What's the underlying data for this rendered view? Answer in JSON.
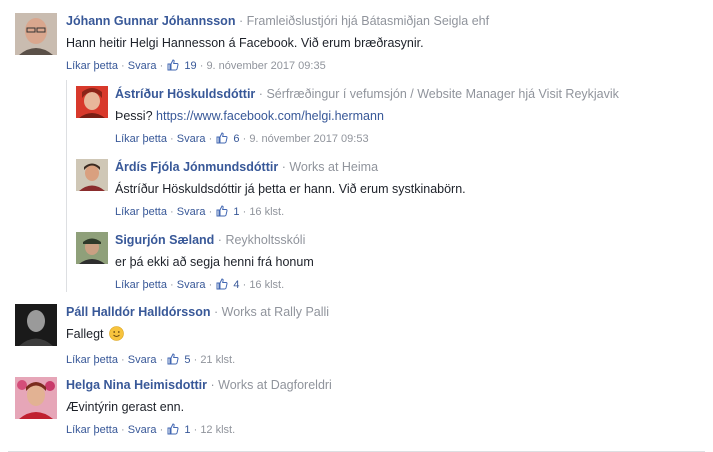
{
  "action_like": "Líkar þetta",
  "action_reply": "Svara",
  "separator": "·",
  "comments": [
    {
      "name": "Jóhann Gunnar Jóhannsson",
      "work": "Framleiðslustjóri hjá Bátasmiðjan Seigla ehf",
      "text": "Hann heitir Helgi Hannesson á Facebook. Við erum bræðrasynir.",
      "likes": "19",
      "time": "9. nóvember 2017 09:35",
      "avatar": "man-glasses-portrait"
    },
    {
      "name": "Ástríður Höskuldsdóttir",
      "work": "Sérfræðingur í vefumsjón / Website Manager hjá Visit Reykjavik",
      "text_prefix": "Þessi?",
      "link": "https://www.facebook.com/helgi.hermann",
      "likes": "6",
      "time": "9. nóvember 2017 09:53",
      "avatar": "woman-red-portrait"
    },
    {
      "name": "Árdís Fjóla Jónmundsdóttir",
      "work": "Works at Heima",
      "text": "Ástríður Höskuldsdóttir já þetta er hann. Við erum systkinabörn.",
      "likes": "1",
      "time": "16 klst.",
      "avatar": "woman-portrait"
    },
    {
      "name": "Sigurjón Sæland",
      "work": "Reykholtsskóli",
      "text": "er þá ekki að segja henni frá honum",
      "likes": "4",
      "time": "16 klst.",
      "avatar": "man-cap-portrait"
    },
    {
      "name": "Páll Halldór Halldórsson",
      "work": "Works at Rally Palli",
      "text": "Fallegt",
      "likes": "5",
      "time": "21 klst.",
      "avatar": "man-bw-portrait"
    },
    {
      "name": "Helga Nina Heimisdottir",
      "work": "Works at Dagforeldri",
      "text": "Ævintýrin gerast enn.",
      "likes": "1",
      "time": "12 klst.",
      "avatar": "woman-flowers-portrait"
    }
  ],
  "colors": {
    "name": "#385898",
    "meta": "#90949c",
    "text": "#1d2129",
    "like": "#4267b2"
  }
}
